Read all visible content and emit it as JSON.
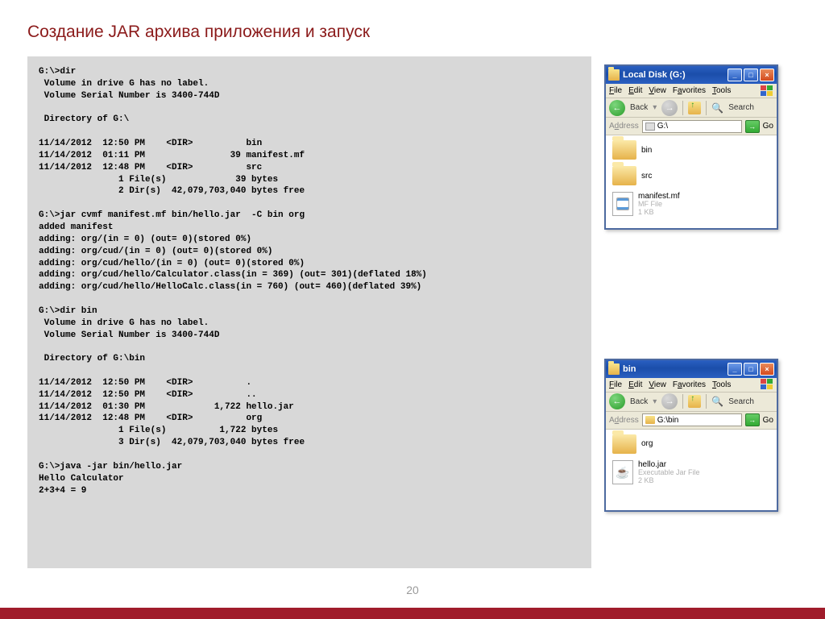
{
  "title": "Создание JAR архива приложения и запуск",
  "page_number": "20",
  "terminal_text": "G:\\>dir\n Volume in drive G has no label.\n Volume Serial Number is 3400-744D\n\n Directory of G:\\\n\n11/14/2012  12:50 PM    <DIR>          bin\n11/14/2012  01:11 PM                39 manifest.mf\n11/14/2012  12:48 PM    <DIR>          src\n               1 File(s)             39 bytes\n               2 Dir(s)  42,079,703,040 bytes free\n\nG:\\>jar cvmf manifest.mf bin/hello.jar  -C bin org\nadded manifest\nadding: org/(in = 0) (out= 0)(stored 0%)\nadding: org/cud/(in = 0) (out= 0)(stored 0%)\nadding: org/cud/hello/(in = 0) (out= 0)(stored 0%)\nadding: org/cud/hello/Calculator.class(in = 369) (out= 301)(deflated 18%)\nadding: org/cud/hello/HelloCalc.class(in = 760) (out= 460)(deflated 39%)\n\nG:\\>dir bin\n Volume in drive G has no label.\n Volume Serial Number is 3400-744D\n\n Directory of G:\\bin\n\n11/14/2012  12:50 PM    <DIR>          .\n11/14/2012  12:50 PM    <DIR>          ..\n11/14/2012  01:30 PM             1,722 hello.jar\n11/14/2012  12:48 PM    <DIR>          org\n               1 File(s)          1,722 bytes\n               3 Dir(s)  42,079,703,040 bytes free\n\nG:\\>java -jar bin/hello.jar\nHello Calculator\n2+3+4 = 9",
  "explorer1": {
    "title": "Local Disk (G:)",
    "menus": {
      "file": "File",
      "edit": "Edit",
      "view": "View",
      "favorites": "Favorites",
      "tools": "Tools"
    },
    "back_label": "Back",
    "search_label": "Search",
    "addr_label": "Address",
    "addr_value": "G:\\",
    "go_label": "Go",
    "items": [
      {
        "type": "folder",
        "name": "bin"
      },
      {
        "type": "folder",
        "name": "src"
      },
      {
        "type": "file",
        "name": "manifest.mf",
        "sub1": "MF File",
        "sub2": "1 KB"
      }
    ]
  },
  "explorer2": {
    "title": "bin",
    "menus": {
      "file": "File",
      "edit": "Edit",
      "view": "View",
      "favorites": "Favorites",
      "tools": "Tools"
    },
    "back_label": "Back",
    "search_label": "Search",
    "addr_label": "Address",
    "addr_value": "G:\\bin",
    "go_label": "Go",
    "items": [
      {
        "type": "folder",
        "name": "org"
      },
      {
        "type": "jar",
        "name": "hello.jar",
        "sub1": "Executable Jar File",
        "sub2": "2 KB"
      }
    ]
  }
}
